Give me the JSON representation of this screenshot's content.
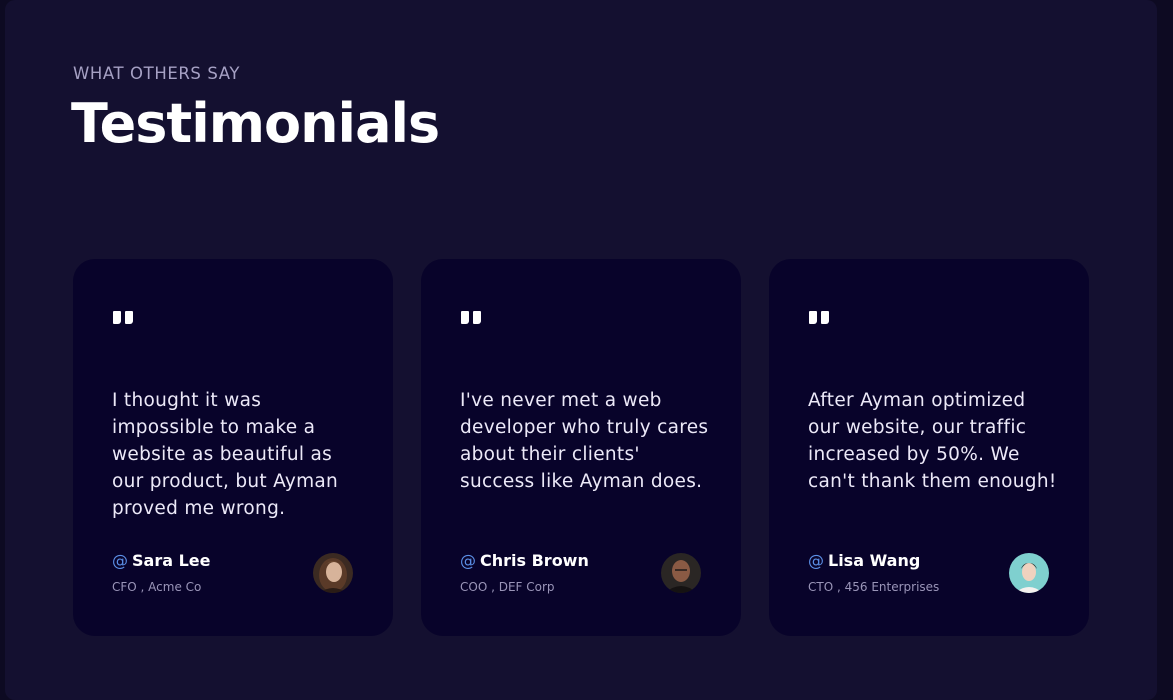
{
  "section": {
    "eyebrow": "WHAT OTHERS SAY",
    "title": "Testimonials"
  },
  "testimonials": [
    {
      "quote": "I thought it was impossible to make a website as beautiful as our product, but Ayman proved me wrong.",
      "at": "@",
      "name": "Sara Lee",
      "role": "CFO , Acme Co",
      "avatar_icon": "avatar-photo"
    },
    {
      "quote": "I've never met a web developer who truly cares about their clients' success like Ayman does.",
      "at": "@",
      "name": "Chris Brown",
      "role": "COO , DEF Corp",
      "avatar_icon": "avatar-photo"
    },
    {
      "quote": "After Ayman optimized our website, our traffic increased by 50%. We can't thank them enough!",
      "at": "@",
      "name": "Lisa Wang",
      "role": "CTO , 456 Enterprises",
      "avatar_icon": "avatar-photo"
    }
  ],
  "colors": {
    "background": "#141030",
    "card": "#08032a",
    "accent": "#5b8fe6",
    "text": "#ffffff"
  }
}
